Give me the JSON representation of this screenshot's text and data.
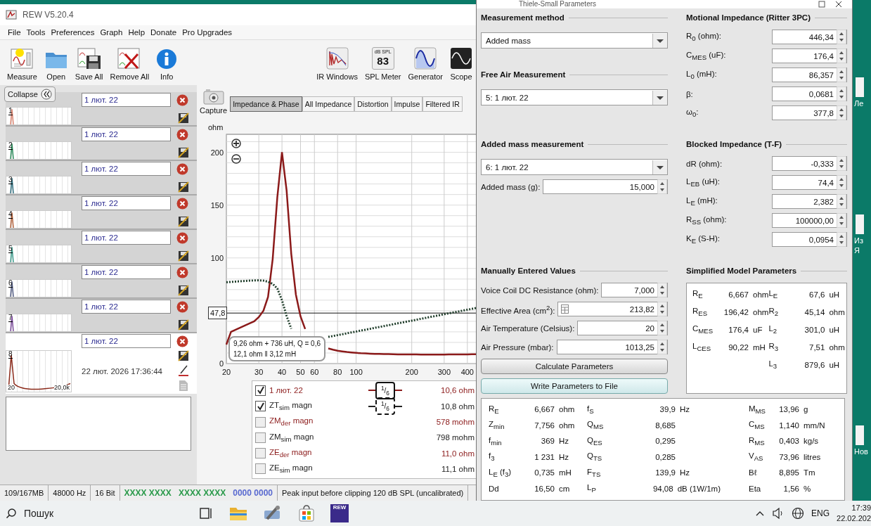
{
  "rew": {
    "title": "REW V5.20.4",
    "menu": [
      "File",
      "Tools",
      "Preferences",
      "Graph",
      "Help",
      "Donate",
      "Pro Upgrades"
    ],
    "toolbar_left": [
      {
        "label": "Measure",
        "kind": "measure"
      },
      {
        "label": "Open",
        "kind": "open"
      },
      {
        "label": "Save All",
        "kind": "save-all"
      },
      {
        "label": "Remove All",
        "kind": "remove-all"
      },
      {
        "label": "Info",
        "kind": "info"
      }
    ],
    "toolbar_right": [
      {
        "label": "IR Windows",
        "kind": "ir-windows"
      },
      {
        "label": "SPL Meter",
        "kind": "spl-meter",
        "display": [
          "dB SPL",
          "83"
        ]
      },
      {
        "label": "Generator",
        "kind": "generator"
      },
      {
        "label": "Scope",
        "kind": "scope"
      }
    ],
    "collapse": "Collapse",
    "measurements": [
      {
        "number": "1",
        "name": "1 лют. 22",
        "color": "#d9826e",
        "selected": false
      },
      {
        "number": "2",
        "name": "1 лют. 22",
        "color": "#2a8a5a",
        "selected": false
      },
      {
        "number": "3",
        "name": "1 лют. 22",
        "color": "#2a6a7a",
        "selected": false
      },
      {
        "number": "4",
        "name": "1 лют. 22",
        "color": "#b0603a",
        "selected": false
      },
      {
        "number": "5",
        "name": "1 лют. 22",
        "color": "#3a9a8a",
        "selected": false
      },
      {
        "number": "6",
        "name": "1 лют. 22",
        "color": "#505a80",
        "selected": false
      },
      {
        "number": "7",
        "name": "1 лют. 22",
        "color": "#7a4a9a",
        "selected": false
      },
      {
        "number": "8",
        "name": "1 лют. 22",
        "color": "#8b2a1a",
        "selected": true,
        "date": "22 лют. 2026 17:36:44",
        "axis": [
          "20",
          "20,0k"
        ]
      }
    ],
    "graph": {
      "capture": "Capture",
      "tabs": [
        {
          "label": "Impedance & Phase",
          "selected": true
        },
        {
          "label": "All Impedance",
          "selected": false
        },
        {
          "label": "Distortion",
          "selected": false
        },
        {
          "label": "Impulse",
          "selected": false
        },
        {
          "label": "Filtered IR",
          "selected": false
        }
      ],
      "fit_text": [
        "9,26 ohm + 736 uH, Q = 0,6",
        "12,1 ohm ‖ 3,12 mH"
      ],
      "chart_data": {
        "type": "line",
        "ylabel": "ohm",
        "ylim": [
          0,
          217
        ],
        "yticks": [
          0,
          100,
          150,
          200
        ],
        "grid": true,
        "ref_lines": [
          {
            "axis": "y",
            "value": 47.8,
            "label": "47,8"
          }
        ],
        "categories": [
          "20",
          null,
          null,
          null,
          null,
          null,
          null,
          "30",
          null,
          null,
          null,
          null,
          "40",
          null,
          null,
          null,
          "50",
          null,
          null,
          "60",
          null,
          null,
          null,
          null,
          "80",
          null,
          null,
          null,
          "100",
          null,
          null,
          null,
          null,
          null,
          null,
          null,
          null,
          null,
          null,
          null,
          "200",
          null,
          null,
          null,
          null,
          null,
          null,
          "300",
          null,
          null,
          null,
          null,
          "400",
          null,
          null
        ],
        "series": [
          {
            "color": "#8b1a1a",
            "line_style": "solid",
            "values": [
              18,
              30,
              32,
              34,
              36,
              38,
              40,
              44,
              50,
              63.2,
              99.0,
              157.5,
              200,
              163.8,
              104,
              65.2,
              44.6,
              32.7,
              null,
              null,
              null,
              null,
              14.3,
              13.1,
              12.2,
              11.5,
              10.9,
              10.5,
              10.1,
              9.8,
              9.6,
              9.4,
              9.2,
              9.1,
              9.0,
              8.9,
              8.8,
              8.7,
              8.7,
              8.6,
              8.6,
              8.6,
              8.5,
              8.5,
              8.5,
              8.5,
              8.5,
              8.5,
              8.6,
              8.6,
              8.6,
              8.7,
              8.7,
              8.8,
              8.8
            ]
          },
          {
            "color": "#1f3d2a",
            "line_style": "dotted",
            "values": [
              77,
              77.3,
              77.6,
              77.9,
              78.2,
              78.5,
              78.7,
              78.8,
              78.5,
              77.5,
              75.5,
              71,
              60,
              45,
              33,
              null,
              null,
              null,
              null,
              null,
              null,
              null,
              25.2,
              26.0,
              26.9,
              27.7,
              28.6,
              29.5,
              30.3,
              31.2,
              32.0,
              32.9,
              33.8,
              34.6,
              35.5,
              36.3,
              37.2,
              38.1,
              38.9,
              39.8,
              40.6,
              41.5,
              42.4,
              43.2,
              44.1,
              44.9,
              45.8,
              46.7,
              47.5,
              48.4,
              49.2,
              50.1,
              51.0,
              51.8,
              52.7
            ]
          }
        ]
      },
      "legend": [
        {
          "name": "1 лют. 22",
          "checked": true,
          "color": "#8b1a1a",
          "smoothing": "$^{1}$/$_{6}$",
          "dashed": false,
          "value": "10,6 ohm"
        },
        {
          "name": "ZT$_{sim}$ magn",
          "checked": true,
          "color": "#222222",
          "smoothing": "$^{1}$/$_{6}$",
          "dashed": true,
          "value": "10,8 ohm"
        },
        {
          "name": "ZM$_{der}$ magn",
          "checked": false,
          "color": "#8b1a1a",
          "value": "578 mohm"
        },
        {
          "name": "ZM$_{sim}$ magn",
          "checked": false,
          "color": "#222222",
          "value": "798 mohm"
        },
        {
          "name": "ZE$_{der}$ magn",
          "checked": false,
          "color": "#8b1a1a",
          "value": "11,0 ohm"
        },
        {
          "name": "ZE$_{sim}$ magn",
          "checked": false,
          "color": "#222222",
          "value": "11,1 ohm"
        }
      ]
    },
    "status_bar": [
      {
        "kind": "text",
        "text": "109/167MB"
      },
      {
        "kind": "text",
        "text": "48000 Hz"
      },
      {
        "kind": "text",
        "text": "16 Bit"
      },
      {
        "kind": "levels",
        "parts": [
          {
            "text": "XXXX XXXX",
            "color": "#2a9a4a"
          },
          {
            "text": "XXXX XXXX",
            "color": "#2a9a4a"
          },
          {
            "text": "0000 0000",
            "color": "#5a6ad0"
          }
        ]
      },
      {
        "kind": "text",
        "text": "Peak input before clipping 120 dB SPL (uncalibrated)"
      }
    ]
  },
  "dialog": {
    "title": "Thiele-Small Parameters",
    "groups": [
      {
        "left": [
          {
            "title": "Measurement method",
            "controls": [
              {
                "kind": "dropdown",
                "value": "Added mass"
              }
            ]
          },
          {
            "title": "Free Air Measurement",
            "controls": [
              {
                "kind": "dropdown",
                "value": "5: 1 лют. 22"
              }
            ]
          }
        ],
        "right": [
          {
            "title": "Motional Impedance (Ritter 3PC)",
            "controls": [
              {
                "kind": "spin",
                "label": "R$_{0}$ (ohm):",
                "value": "446,34"
              },
              {
                "kind": "spin",
                "label": "C$_{MES}$ (uF):",
                "value": "176,4"
              },
              {
                "kind": "spin",
                "label": "L$_{0}$ (mH):",
                "value": "86,357"
              },
              {
                "kind": "spin",
                "label": "β:",
                "value": "0,0681"
              },
              {
                "kind": "spin",
                "label": "ω$_{0}$:",
                "value": "377,8"
              }
            ]
          }
        ]
      },
      {
        "left": [
          {
            "title": "Added mass measurement",
            "controls": [
              {
                "kind": "dropdown",
                "value": "6: 1 лют. 22"
              },
              {
                "kind": "spin",
                "label": "Added mass (g):",
                "value": "15,000"
              }
            ]
          }
        ],
        "right": [
          {
            "title": "Blocked Impedance (T-F)",
            "controls": [
              {
                "kind": "spin",
                "label": "dR (ohm):",
                "value": "-0,333"
              },
              {
                "kind": "spin",
                "label": "L$_{EB}$ (uH):",
                "value": "74,4"
              },
              {
                "kind": "spin",
                "label": "L$_{E}$ (mH):",
                "value": "2,382"
              },
              {
                "kind": "spin",
                "label": "R$_{SS}$ (ohm):",
                "value": "100000,00"
              },
              {
                "kind": "spin",
                "label": "K$_{E}$ (S-H):",
                "value": "0,0954"
              }
            ]
          }
        ]
      },
      {
        "left": [
          {
            "title": "Manually Entered Values",
            "controls": [
              {
                "kind": "spin",
                "label": "Voice Coil DC Resistance (ohm):",
                "value": "7,000"
              },
              {
                "kind": "spin",
                "label": "Effective Area (cm$^{2}$):",
                "value": "213,82",
                "calculator": true
              },
              {
                "kind": "spin",
                "label": "Air Temperature (Celsius):",
                "value": "20"
              },
              {
                "kind": "spin",
                "label": "Air Pressure (mbar):",
                "value": "1013,25"
              },
              {
                "kind": "button",
                "label": "Calculate Parameters",
                "focused": false
              },
              {
                "kind": "button",
                "label": "Write Parameters to File",
                "focused": true
              }
            ]
          }
        ],
        "right": [
          {
            "title": "Simplified Model Parameters",
            "controls": [
              {
                "kind": "params",
                "columns": [
                  [
                    {
                      "sym": "R$_{E}$",
                      "value": "6,667",
                      "unit": "ohm"
                    },
                    {
                      "sym": "R$_{ES}$",
                      "value": "196,42",
                      "unit": "ohm"
                    },
                    {
                      "sym": "C$_{MES}$",
                      "value": "176,4",
                      "unit": "uF"
                    },
                    {
                      "sym": "L$_{CES}$",
                      "value": "90,22",
                      "unit": "mH"
                    }
                  ],
                  [
                    {
                      "sym": "L$_{E}$",
                      "value": "67,6",
                      "unit": "uH"
                    },
                    {
                      "sym": "R$_{2}$",
                      "value": "45,14",
                      "unit": "ohm"
                    },
                    {
                      "sym": "L$_{2}$",
                      "value": "301,0",
                      "unit": "uH"
                    },
                    {
                      "sym": "R$_{3}$",
                      "value": "7,51",
                      "unit": "ohm"
                    },
                    {
                      "sym": "L$_{3}$",
                      "value": "879,6",
                      "unit": "uH"
                    }
                  ]
                ]
              }
            ]
          }
        ]
      }
    ],
    "results": [
      [
        {
          "sym": "R$_{E}$",
          "value": "6,667",
          "unit": "ohm"
        },
        {
          "sym": "Z$_{min}$",
          "value": "7,756",
          "unit": "ohm"
        },
        {
          "sym": "f$_{min}$",
          "value": "369",
          "unit": "Hz"
        },
        {
          "sym": "f$_{3}$",
          "value": "1 231",
          "unit": "Hz"
        },
        {
          "sym": "L$_{E}$ (f$_{3}$)",
          "value": "0,735",
          "unit": "mH"
        },
        {
          "sym": "Dd",
          "value": "16,50",
          "unit": "cm"
        }
      ],
      [
        {
          "sym": "f$_{S}$",
          "value": "39,9",
          "unit": "Hz"
        },
        {
          "sym": "Q$_{MS}$",
          "value": "8,685"
        },
        {
          "sym": "Q$_{ES}$",
          "value": "0,295"
        },
        {
          "sym": "Q$_{TS}$",
          "value": "0,285"
        },
        {
          "sym": "F$_{TS}$",
          "value": "139,9",
          "unit": "Hz"
        },
        {
          "sym": "L$_{P}$",
          "value": "94,08",
          "unit": "dB (1W/1m)"
        }
      ],
      [
        {
          "sym": "M$_{MS}$",
          "value": "13,96",
          "unit": "g"
        },
        {
          "sym": "C$_{MS}$",
          "value": "1,140",
          "unit": "mm/N"
        },
        {
          "sym": "R$_{MS}$",
          "value": "0,403",
          "unit": "kg/s"
        },
        {
          "sym": "V$_{AS}$",
          "value": "73,96",
          "unit": "litres"
        },
        {
          "sym": "Bℓ",
          "value": "8,895",
          "unit": "Tm"
        },
        {
          "sym": "Eta",
          "value": "1,56",
          "unit": "%"
        }
      ]
    ]
  },
  "desktop_icons": [
    {
      "lines": [
        "Ле"
      ]
    },
    {
      "lines": [
        "Из",
        "Я"
      ]
    },
    {
      "lines": [
        "Нов"
      ]
    }
  ],
  "taskbar": {
    "search": {
      "placeholder": "Пошук"
    },
    "apps": [
      {
        "kind": "task-view"
      },
      {
        "kind": "explorer"
      },
      {
        "kind": "tool"
      },
      {
        "kind": "store"
      },
      {
        "kind": "rew",
        "label": "REW"
      }
    ],
    "language": "ENG",
    "time": "17:39",
    "date": "22.02.202"
  }
}
